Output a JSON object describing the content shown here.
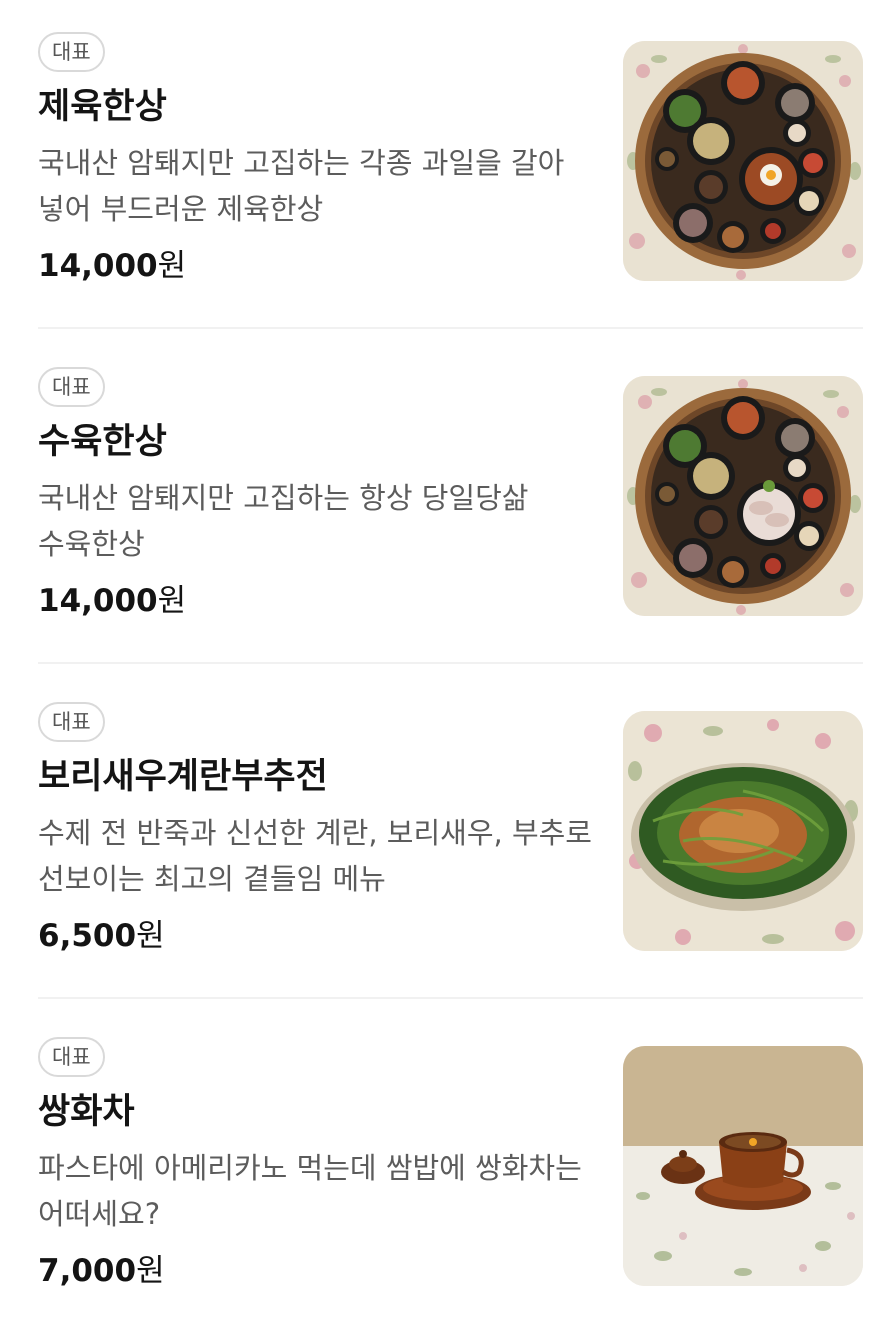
{
  "menu": {
    "items": [
      {
        "badge": "대표",
        "name": "제육한상",
        "description": "국내산 암퇘지만 고집하는 각종 과일을 갈아 넣어 부드러운 제육한상",
        "price_number": "14,000",
        "price_unit": "원",
        "image_icon": "jeyuk-tray-photo"
      },
      {
        "badge": "대표",
        "name": "수육한상",
        "description": "국내산 암퇘지만 고집하는 항상 당일당삶 수육한상",
        "price_number": "14,000",
        "price_unit": "원",
        "image_icon": "suyuk-tray-photo"
      },
      {
        "badge": "대표",
        "name": "보리새우계란부추전",
        "description": "수제 전 반죽과 신선한 계란, 보리새우, 부추로 선보이는 최고의 곁들임 메뉴",
        "price_number": "6,500",
        "price_unit": "원",
        "image_icon": "chive-pancake-photo"
      },
      {
        "badge": "대표",
        "name": "쌍화차",
        "description": "파스타에 아메리카노 먹는데 쌈밥에 쌍화차는 어떠세요?",
        "price_number": "7,000",
        "price_unit": "원",
        "image_icon": "ssanghwa-tea-photo"
      }
    ]
  },
  "colors": {
    "text_primary": "#141414",
    "text_secondary": "#5c5c5c",
    "badge_border": "#d9d9d9",
    "divider": "#f1f1f1"
  }
}
